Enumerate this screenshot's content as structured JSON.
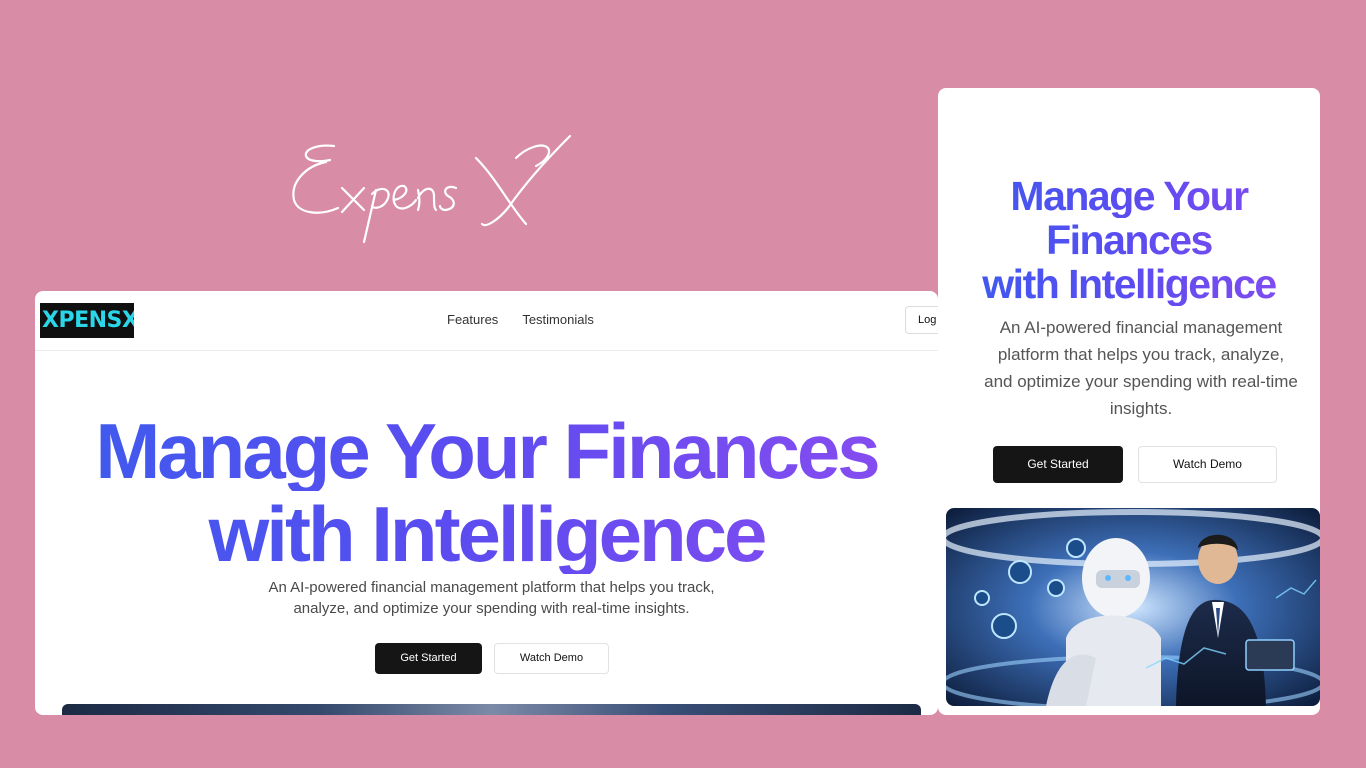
{
  "title_script": "ExpensX",
  "desktop": {
    "logo_text": "XPENSX",
    "nav": {
      "features": "Features",
      "testimonials": "Testimonials",
      "login": "Log"
    },
    "hero": {
      "line1": "Manage Your Finances",
      "line2": "with Intelligence"
    },
    "subtitle_line1": "An AI-powered financial management platform that helps you track,",
    "subtitle_line2": "analyze, and optimize your spending with real-time insights.",
    "get_started": "Get Started",
    "watch_demo": "Watch Demo"
  },
  "mobile": {
    "hero": {
      "line1": "Manage Your",
      "line2": "Finances",
      "line3": "with Intelligence"
    },
    "subtitle_lines": [
      "An AI-powered financial management",
      "platform that helps you track, analyze,",
      "and optimize your spending with real-time",
      "insights."
    ],
    "get_started": "Get Started",
    "watch_demo": "Watch Demo"
  },
  "colors": {
    "background": "#d98ca6",
    "gradient_start": "#3d5cee",
    "gradient_end": "#8a4cf0",
    "logo_text": "#2ad6e8",
    "button_dark": "#151515"
  }
}
